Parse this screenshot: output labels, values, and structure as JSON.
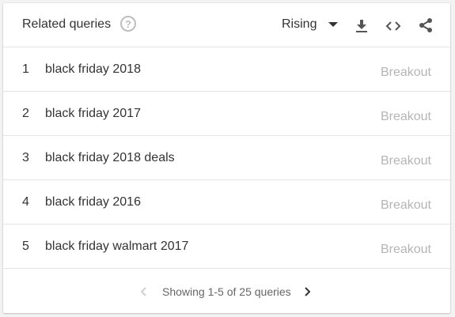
{
  "header": {
    "title": "Related queries",
    "help_icon": "help-circle-icon",
    "help_glyph": "?",
    "filter_label": "Rising",
    "icons": [
      "dropdown-caret-icon",
      "download-icon",
      "embed-code-icon",
      "share-icon"
    ]
  },
  "rows": [
    {
      "rank": "1",
      "query": "black friday 2018",
      "value": "Breakout"
    },
    {
      "rank": "2",
      "query": "black friday 2017",
      "value": "Breakout"
    },
    {
      "rank": "3",
      "query": "black friday 2018 deals",
      "value": "Breakout"
    },
    {
      "rank": "4",
      "query": "black friday 2016",
      "value": "Breakout"
    },
    {
      "rank": "5",
      "query": "black friday walmart 2017",
      "value": "Breakout"
    }
  ],
  "footer": {
    "pager_text": "Showing 1-5 of 25 queries",
    "prev_icon": "chevron-left-icon",
    "next_icon": "chevron-right-icon"
  },
  "colors": {
    "text": "#333333",
    "muted": "#b5b5b5",
    "divider": "#e6e6e6",
    "disabled_icon": "#cfcfcf"
  }
}
